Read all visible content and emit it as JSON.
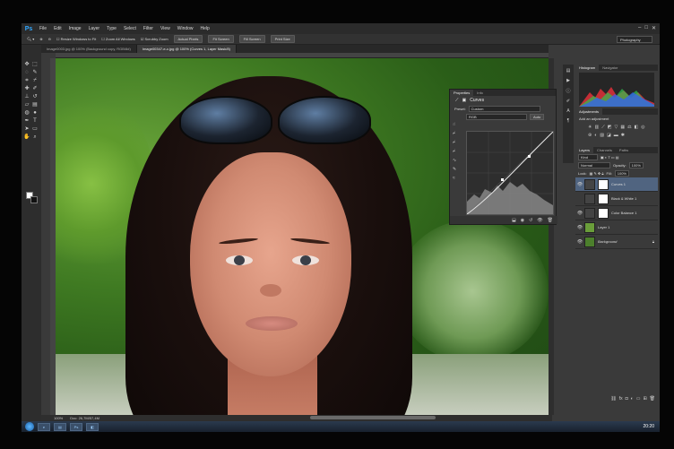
{
  "app": {
    "logo": "Ps"
  },
  "menu": [
    "File",
    "Edit",
    "Image",
    "Layer",
    "Type",
    "Select",
    "Filter",
    "View",
    "Window",
    "Help"
  ],
  "options": {
    "resize_windows": "Resize Windows to Fit",
    "zoom_all": "Zoom All Windows",
    "scrubby_zoom": "Scrubby Zoom",
    "actual_pixels": "Actual Pixels",
    "fit_screen": "Fit Screen",
    "fill_screen": "Fill Screen",
    "print_size": "Print Size",
    "workspace": "Photography"
  },
  "tabs": [
    "Image0003.jpg @ 100% (Background copy, RGB/8#)",
    "Image00347-e-c.jpg @ 100% (Curves 1, Layer Mask/8)"
  ],
  "properties": {
    "tab_properties": "Properties",
    "tab_info": "Info",
    "title": "Curves",
    "preset_label": "Preset:",
    "preset_value": "Custom",
    "channel": "RGB",
    "auto": "Auto"
  },
  "panels": {
    "histogram_tab": "Histogram",
    "navigator_tab": "Navigator",
    "adjustments_tab": "Adjustments",
    "add_adjustment": "Add an adjustment",
    "layers_tab": "Layers",
    "channels_tab": "Channels",
    "paths_tab": "Paths",
    "kind": "Kind",
    "blend_mode": "Normal",
    "opacity_label": "Opacity:",
    "opacity_value": "100%",
    "lock_label": "Lock:",
    "fill_label": "Fill:",
    "fill_value": "100%"
  },
  "layers": [
    {
      "name": "Curves 1",
      "selected": true,
      "thumb": "#ffffff"
    },
    {
      "name": "Black & White 1",
      "selected": false,
      "thumb": "#ffffff"
    },
    {
      "name": "Color Balance 1",
      "selected": false,
      "thumb": "#ffffff"
    },
    {
      "name": "Layer 1",
      "selected": false,
      "thumb": "#6a9d3a"
    },
    {
      "name": "Background",
      "selected": false,
      "thumb": "#4c7f2c"
    }
  ],
  "status": {
    "zoom": "100%",
    "doc": "Doc: 26,7M/57,4M"
  },
  "taskbar": {
    "clock": "20:20"
  },
  "colors": {
    "accent": "#31a8ff",
    "selected_layer": "#506480"
  }
}
